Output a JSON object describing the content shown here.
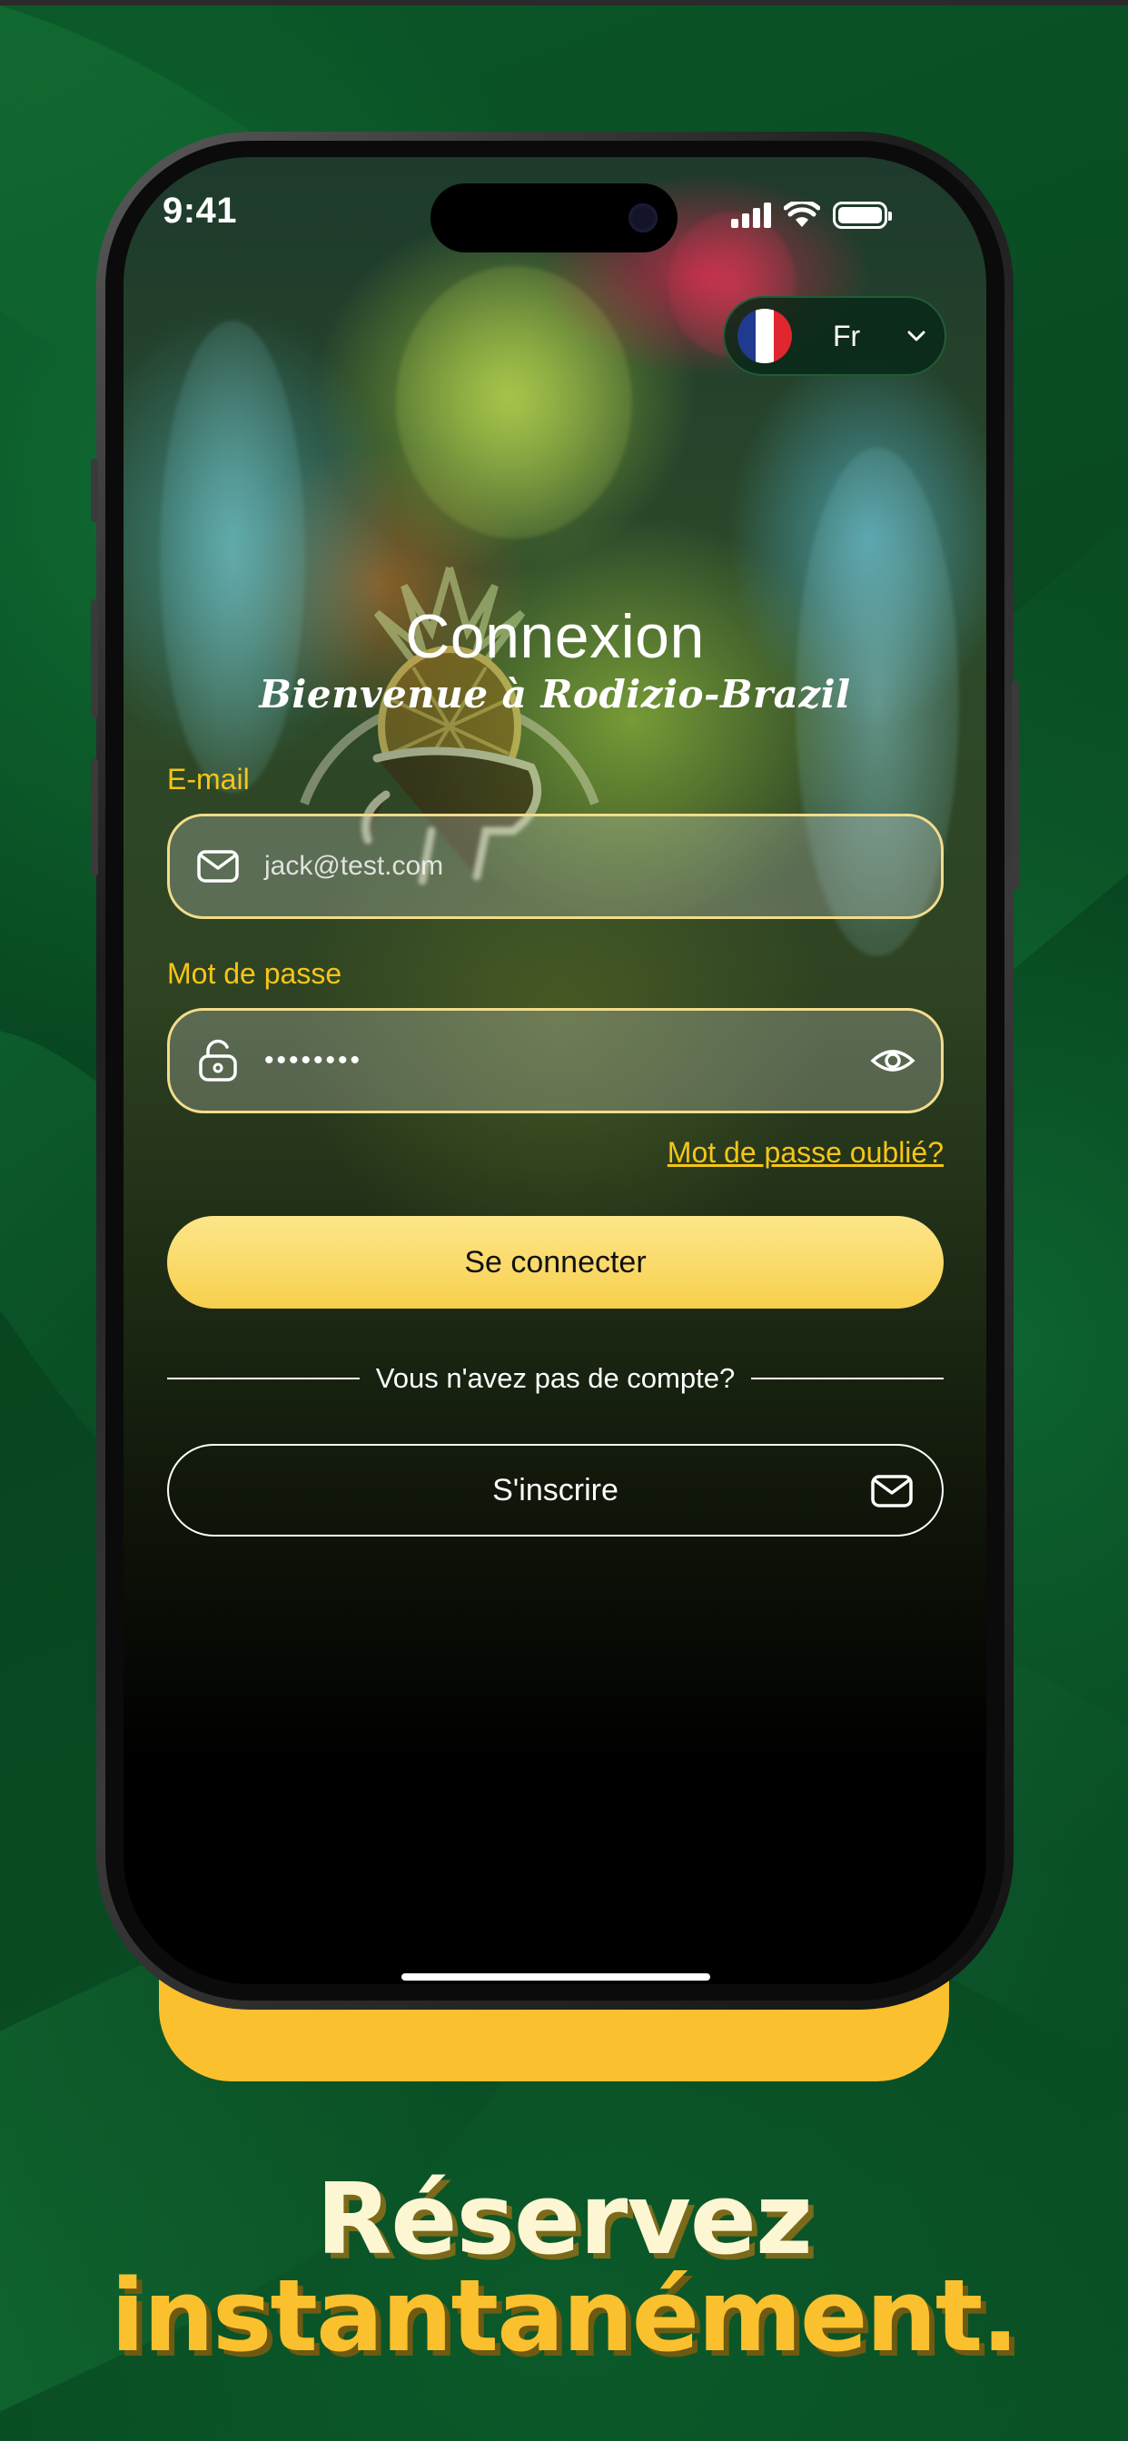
{
  "status_bar": {
    "time": "9:41"
  },
  "language": {
    "code_label": "Fr",
    "flag": "france-flag"
  },
  "login": {
    "title": "Connexion",
    "subtitle": "Bienvenue à Rodizio-Brazil",
    "email_label": "E-mail",
    "email_value": "jack@test.com",
    "password_label": "Mot de passe",
    "password_value": "••••••••",
    "forgot_password": "Mot de passe oublié?",
    "login_button": "Se connecter",
    "no_account_text": "Vous n'avez pas de compte?",
    "signup_button": "S'inscrire"
  },
  "promo": {
    "line1": "Réservez",
    "line2": "instantanément."
  },
  "colors": {
    "accent_yellow": "#f5c518",
    "button_yellow": "#f7cf4c",
    "background_green": "#0a4a22"
  }
}
